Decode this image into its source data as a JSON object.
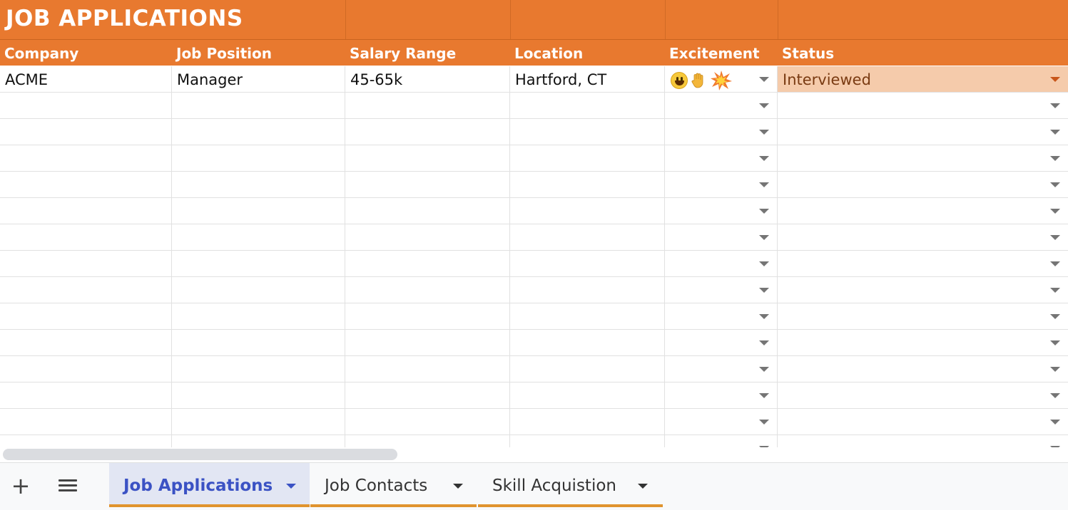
{
  "sheet": {
    "title": "JOB APPLICATIONS",
    "headers": [
      "Company",
      "Job Position",
      "Salary Range",
      "Location",
      "Excitement",
      "Status"
    ],
    "rows": [
      {
        "company": "ACME",
        "position": "Manager",
        "salary": "45-65k",
        "location": "Hartford, CT",
        "excitement_icons": [
          "smiley-face-icon",
          "raised-hand-icon",
          "collision-icon"
        ],
        "status": "Interviewed"
      }
    ],
    "empty_row_count": 14
  },
  "colors": {
    "header_bg": "#e8792f",
    "status_chip_bg": "#f5cbab",
    "active_tab_bg": "#e2e6f3",
    "tab_accent": "#e0932e"
  },
  "tabs": [
    {
      "label": "Job Applications",
      "active": true
    },
    {
      "label": "Job Contacts",
      "active": false
    },
    {
      "label": "Skill Acquistion",
      "active": false
    }
  ],
  "toolbar": {
    "add_sheet_label": "+",
    "add_sheet_icon": "plus-icon",
    "all_sheets_icon": "menu-icon"
  }
}
